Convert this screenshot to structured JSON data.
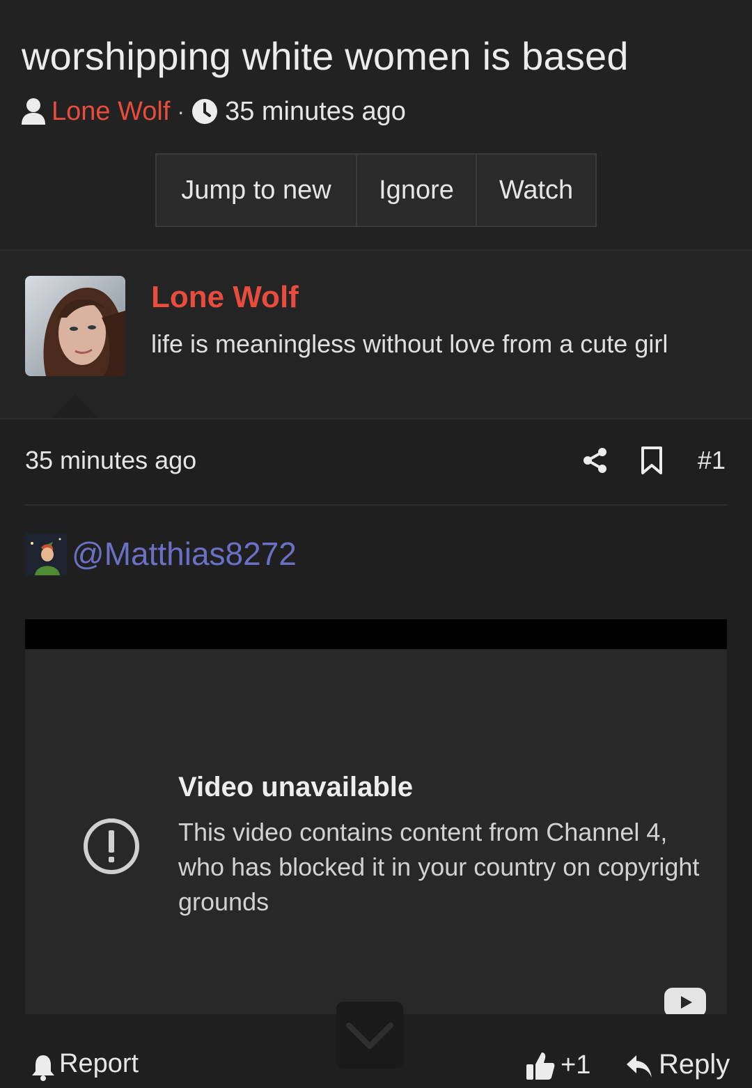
{
  "thread": {
    "title": "worshipping white women is based",
    "author": "Lone Wolf",
    "separator": "·",
    "time": "35 minutes ago"
  },
  "actions": {
    "jump": "Jump to new",
    "ignore": "Ignore",
    "watch": "Watch"
  },
  "author_block": {
    "name": "Lone Wolf",
    "signature": "life is meaningless without love from a cute girl"
  },
  "post": {
    "time": "35 minutes ago",
    "number": "#1",
    "mention": "@Matthias8272"
  },
  "video": {
    "title": "Video unavailable",
    "message": "This video contains content from Channel 4, who has blocked it in your country on copyright grounds"
  },
  "footer": {
    "report": "Report",
    "like": "+1",
    "reply": "Reply"
  },
  "colors": {
    "accent": "#e74c3c",
    "mention": "#6a70c4",
    "background": "#1f1f1f"
  }
}
